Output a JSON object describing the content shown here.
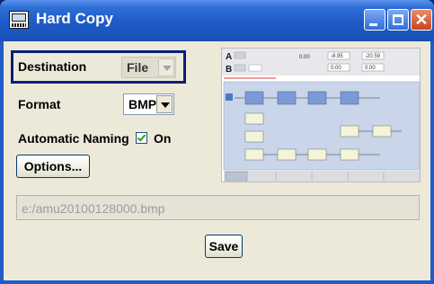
{
  "window": {
    "title": "Hard Copy",
    "icon": "printer-screen-icon",
    "controls": [
      "minimize-icon",
      "maximize-icon",
      "close-icon"
    ],
    "close_glyph": "✕"
  },
  "destination": {
    "label": "Destination",
    "value": "File"
  },
  "format": {
    "label": "Format",
    "value": "BMP"
  },
  "automatic_naming": {
    "label": "Automatic Naming",
    "checked": true,
    "state_label": "On"
  },
  "options_button": {
    "label": "Options..."
  },
  "file_path": {
    "value": "e:/amu20100128000.bmp"
  },
  "save_button": {
    "label": "Save"
  },
  "preview": {
    "header_a": "A",
    "header_b": "B",
    "value_1": "0.00",
    "value_2": "-8.95",
    "value_3": "-20.59",
    "value_4": "0.00",
    "value_5": "0.00"
  },
  "colors": {
    "title_bar": "#1F5CC8",
    "window_body": "#ECE9D8",
    "selected_frame": "#0A1E7A",
    "close_button": "#C8441D",
    "checkmark": "#21A121"
  }
}
